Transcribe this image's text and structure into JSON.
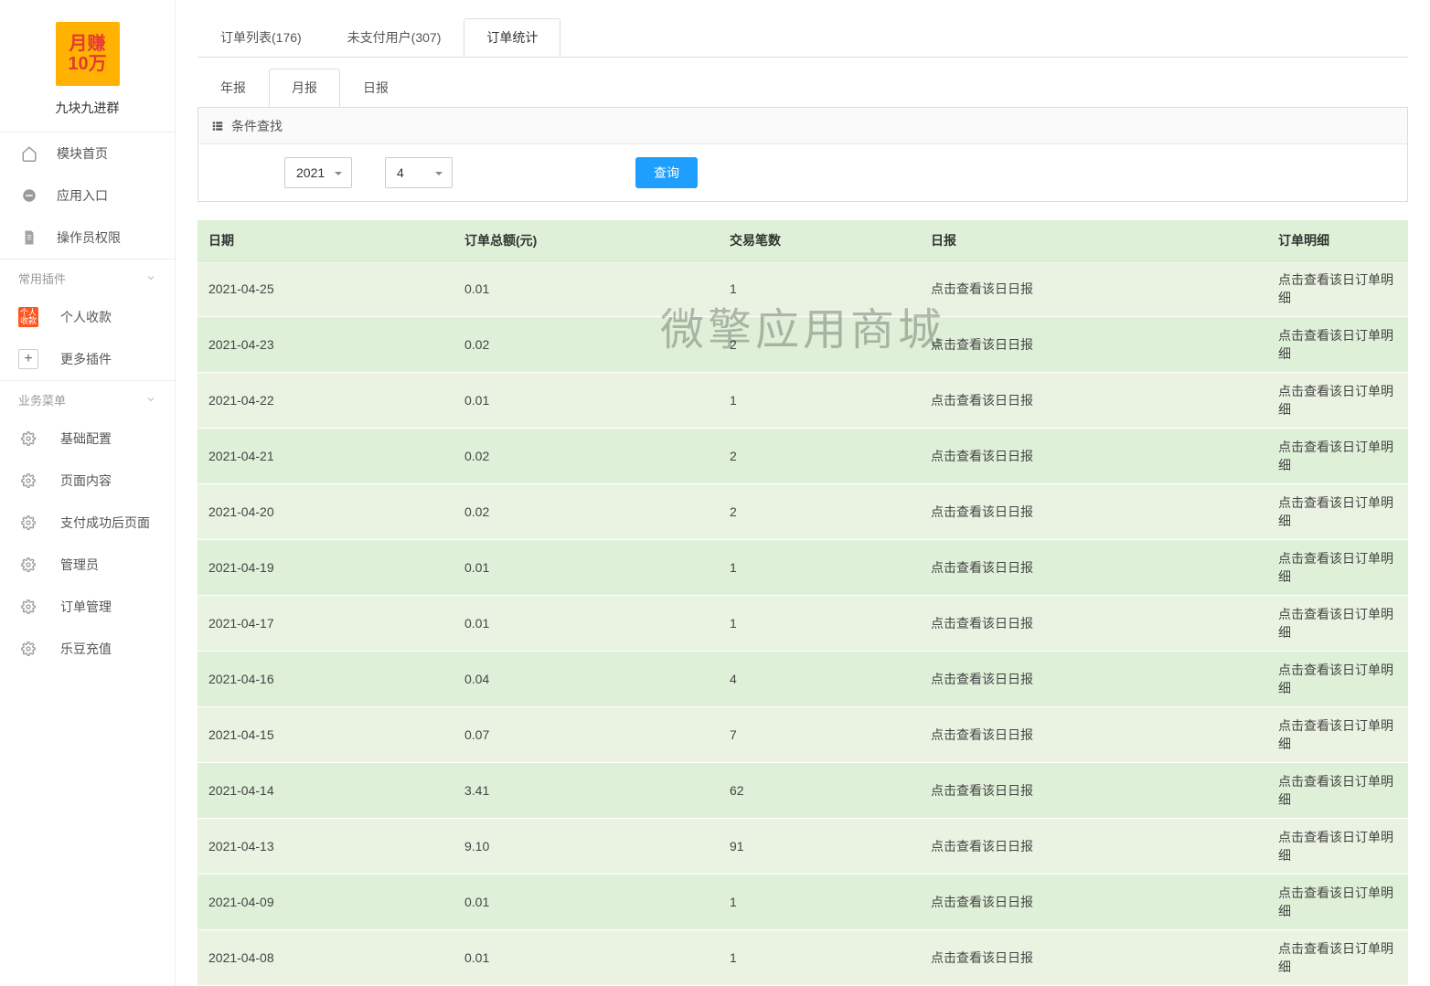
{
  "sidebar": {
    "logo_line1": "月赚",
    "logo_line2": "10万",
    "logo_sub": "九块九进群",
    "nav": [
      {
        "label": "模块首页",
        "icon": "home"
      },
      {
        "label": "应用入口",
        "icon": "chat"
      },
      {
        "label": "操作员权限",
        "icon": "doc"
      }
    ],
    "group_plugins": "常用插件",
    "plugin_income": "个人收款",
    "plugin_more": "更多插件",
    "group_biz": "业务菜单",
    "biz": [
      {
        "label": "基础配置"
      },
      {
        "label": "页面内容"
      },
      {
        "label": "支付成功后页面"
      },
      {
        "label": "管理员"
      },
      {
        "label": "订单管理"
      },
      {
        "label": "乐豆充值"
      }
    ]
  },
  "top_tabs": [
    {
      "label": "订单列表(176)"
    },
    {
      "label": "未支付用户(307)"
    },
    {
      "label": "订单统计",
      "active": true
    }
  ],
  "sub_tabs": [
    {
      "label": "年报"
    },
    {
      "label": "月报",
      "active": true
    },
    {
      "label": "日报"
    }
  ],
  "filter": {
    "title": "条件查找",
    "year": "2021",
    "month": "4",
    "query": "查询"
  },
  "table": {
    "headers": [
      "日期",
      "订单总额(元)",
      "交易笔数",
      "日报",
      "订单明细"
    ],
    "report_link": "点击查看该日日报",
    "detail_link": "点击查看该日订单明细",
    "rows": [
      {
        "date": "2021-04-25",
        "amount": "0.01",
        "count": "1"
      },
      {
        "date": "2021-04-23",
        "amount": "0.02",
        "count": "2"
      },
      {
        "date": "2021-04-22",
        "amount": "0.01",
        "count": "1"
      },
      {
        "date": "2021-04-21",
        "amount": "0.02",
        "count": "2"
      },
      {
        "date": "2021-04-20",
        "amount": "0.02",
        "count": "2"
      },
      {
        "date": "2021-04-19",
        "amount": "0.01",
        "count": "1"
      },
      {
        "date": "2021-04-17",
        "amount": "0.01",
        "count": "1"
      },
      {
        "date": "2021-04-16",
        "amount": "0.04",
        "count": "4"
      },
      {
        "date": "2021-04-15",
        "amount": "0.07",
        "count": "7"
      },
      {
        "date": "2021-04-14",
        "amount": "3.41",
        "count": "62"
      },
      {
        "date": "2021-04-13",
        "amount": "9.10",
        "count": "91"
      },
      {
        "date": "2021-04-09",
        "amount": "0.01",
        "count": "1"
      },
      {
        "date": "2021-04-08",
        "amount": "0.01",
        "count": "1"
      }
    ]
  },
  "watermark": "微擎应用商城"
}
